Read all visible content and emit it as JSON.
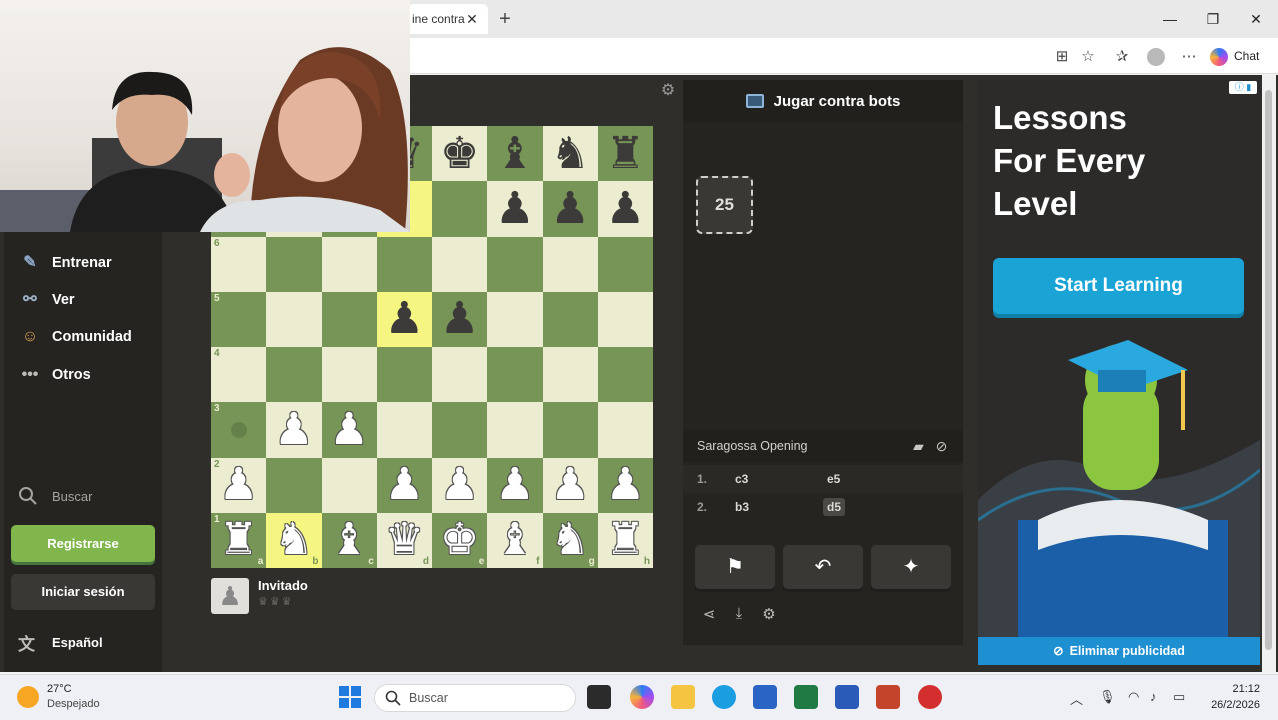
{
  "browser": {
    "tab_title": "ine contra",
    "tab_close": "✕",
    "new_tab": "+",
    "chat_label": "Chat",
    "window": {
      "minimize": "—",
      "maximize": "❐",
      "close": "✕"
    }
  },
  "sidebar": {
    "items": [
      {
        "label": "Entrenar",
        "icon": "puzzle-icon"
      },
      {
        "label": "Ver",
        "icon": "binoculars-icon"
      },
      {
        "label": "Comunidad",
        "icon": "community-icon"
      },
      {
        "label": "Otros",
        "icon": "more-dots-icon"
      }
    ],
    "search_label": "Buscar",
    "register_label": "Registrarse",
    "login_label": "Iniciar sesión",
    "language_label": "Español"
  },
  "game": {
    "panel_title": "Jugar contra bots",
    "bot_level": "25",
    "opening_name": "Saragossa Opening",
    "moves": [
      {
        "num": "1.",
        "white": "c3",
        "black": "e5"
      },
      {
        "num": "2.",
        "white": "b3",
        "black": "d5"
      }
    ],
    "player_name": "Invitado",
    "rank_labels": [
      "6",
      "5",
      "4",
      "3",
      "2",
      "1"
    ],
    "file_labels": [
      "a",
      "b",
      "c",
      "d",
      "e",
      "f",
      "g",
      "h"
    ]
  },
  "ad": {
    "title_lines": [
      "Lessons",
      "For Every",
      "Level"
    ],
    "cta": "Start Learning",
    "remove_ads": "Eliminar publicidad"
  },
  "taskbar": {
    "temperature": "27°C",
    "weather": "Despejado",
    "search_placeholder": "Buscar",
    "time": "21:12",
    "date": "26/2/2026"
  },
  "colors": {
    "board_light": "#ebecd0",
    "board_dark": "#779556",
    "highlight": "#f5f682",
    "brand_green": "#81b64c",
    "ad_blue": "#1aa4d6"
  }
}
